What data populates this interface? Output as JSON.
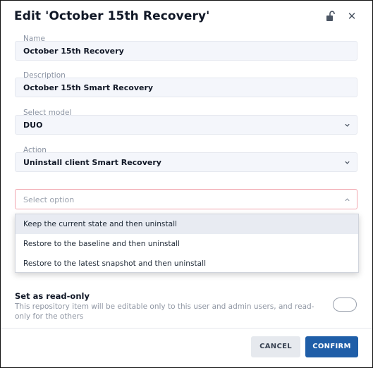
{
  "dialog": {
    "title": "Edit 'October 15th Recovery'"
  },
  "form": {
    "name": {
      "label": "Name",
      "value": "October 15th Recovery"
    },
    "description": {
      "label": "Description",
      "value": "October 15th Smart Recovery"
    },
    "model": {
      "label": "Select model",
      "value": "DUO"
    },
    "action": {
      "label": "Action",
      "value": "Uninstall client Smart Recovery"
    },
    "option_select": {
      "placeholder": "Select option"
    }
  },
  "dropdown": {
    "options": [
      "Keep the current state and then uninstall",
      "Restore to the baseline and then uninstall",
      "Restore to the latest snapshot and then uninstall"
    ]
  },
  "readonly": {
    "title": "Set as read-only",
    "description": "This repository item will be editable only to this user and admin users, and read-only for the others",
    "enabled": false
  },
  "footer": {
    "cancel_label": "CANCEL",
    "confirm_label": "CONFIRM"
  },
  "colors": {
    "confirm": "#1f5ea8",
    "error_border": "#f2a5ae"
  }
}
